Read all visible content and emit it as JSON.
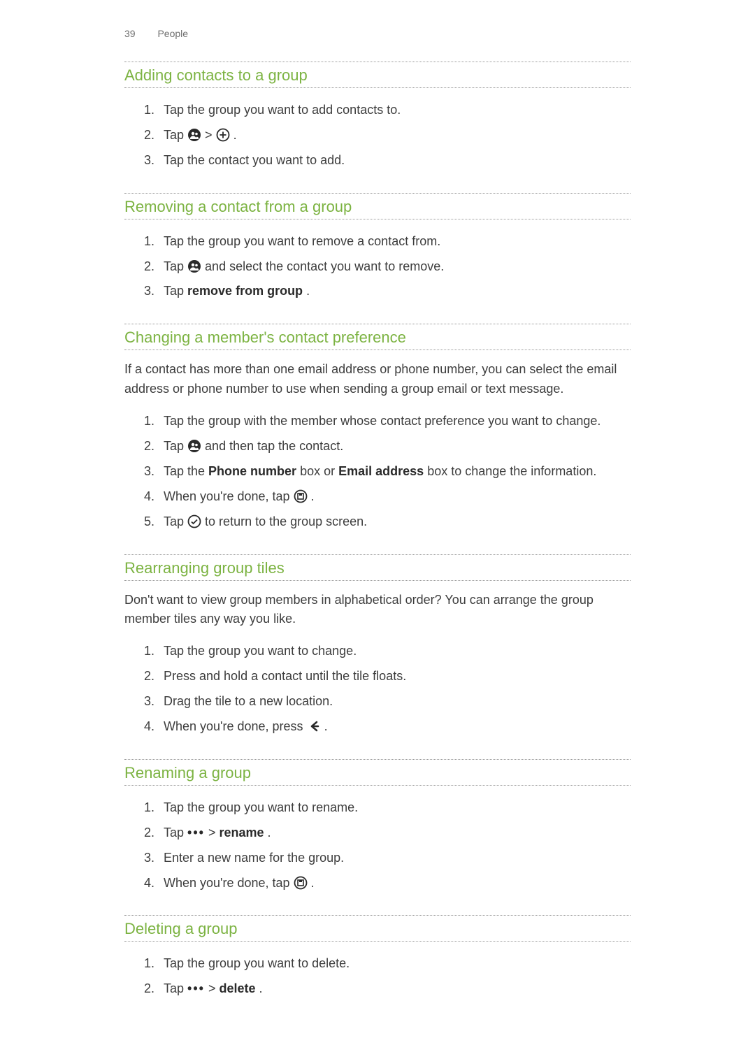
{
  "header": {
    "page_number": "39",
    "section_title": "People"
  },
  "sections": {
    "adding": {
      "heading": "Adding contacts to a group",
      "steps": {
        "s1": "Tap the group you want to add contacts to.",
        "s2": {
          "pre": "Tap ",
          "sep": " > ",
          "post": "."
        },
        "s3": "Tap the contact you want to add."
      }
    },
    "removing": {
      "heading": "Removing a contact from a group",
      "steps": {
        "s1": "Tap the group you want to remove a contact from.",
        "s2": {
          "pre": "Tap ",
          "post": " and select the contact you want to remove."
        },
        "s3": {
          "pre": "Tap ",
          "bold": "remove from group",
          "post": "."
        }
      }
    },
    "changing": {
      "heading": "Changing a member's contact preference",
      "intro": "If a contact has more than one email address or phone number, you can select the email address or phone number to use when sending a group email or text message.",
      "steps": {
        "s1": "Tap the group with the member whose contact preference you want to change.",
        "s2": {
          "pre": "Tap ",
          "post": " and then tap the contact."
        },
        "s3": {
          "pre": "Tap the ",
          "b1": "Phone number",
          "mid": " box or ",
          "b2": "Email address",
          "post": " box to change the information."
        },
        "s4": {
          "pre": "When you're done, tap ",
          "post": "."
        },
        "s5": {
          "pre": "Tap ",
          "post": " to return to the group screen."
        }
      }
    },
    "rearranging": {
      "heading": "Rearranging group tiles",
      "intro": "Don't want to view group members in alphabetical order? You can arrange the group member tiles any way you like.",
      "steps": {
        "s1": "Tap the group you want to change.",
        "s2": "Press and hold a contact until the tile floats.",
        "s3": "Drag the tile to a new location.",
        "s4": {
          "pre": "When you're done, press  ",
          "post": " ."
        }
      }
    },
    "renaming": {
      "heading": "Renaming a group",
      "steps": {
        "s1": "Tap the group you want to rename.",
        "s2": {
          "pre": "Tap ",
          "dots": "•••",
          "sep": "  > ",
          "bold": "rename",
          "post": "."
        },
        "s3": "Enter a new name for the group.",
        "s4": {
          "pre": "When you're done, tap ",
          "post": "."
        }
      }
    },
    "deleting": {
      "heading": "Deleting a group",
      "steps": {
        "s1": "Tap the group you want to delete.",
        "s2": {
          "pre": "Tap ",
          "dots": "•••",
          "sep": "  > ",
          "bold": "delete",
          "post": "."
        }
      }
    }
  },
  "icons": {
    "group": "group-icon",
    "plus": "plus-circle-icon",
    "save": "save-circle-icon",
    "check": "check-circle-icon",
    "back": "back-arrow-icon",
    "more": "more-dots-icon"
  }
}
